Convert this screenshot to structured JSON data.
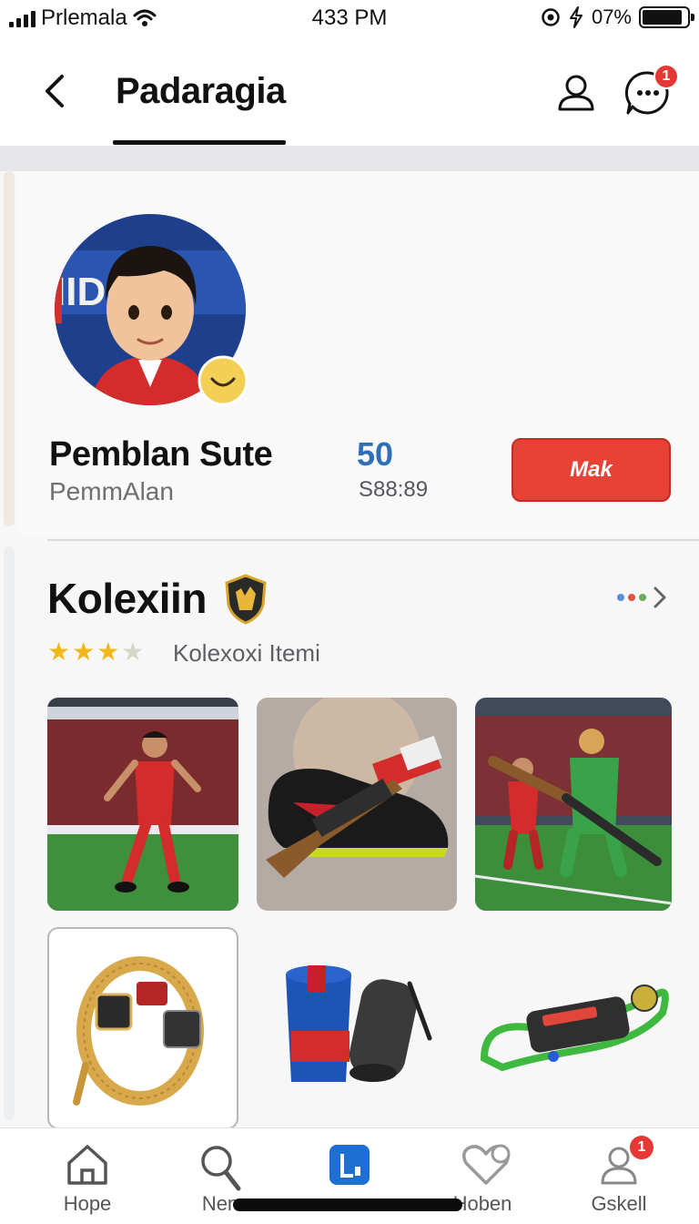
{
  "status_bar": {
    "carrier": "Prlemala",
    "time": "433 PM",
    "battery": "07%"
  },
  "header": {
    "title": "Padaragia",
    "notification_count": "1"
  },
  "profile": {
    "name": "Pemblan Sute",
    "subtitle": "PemmAlan",
    "stat_value": "50",
    "stat_label": "S88:89",
    "action_label": "Mak"
  },
  "collection": {
    "title": "Kolexiin",
    "subtitle": "Kolexoxi Itemi",
    "rating": 3,
    "rating_max": 4
  },
  "bottom_nav": {
    "items": [
      {
        "label": "Hope",
        "icon": "home-icon"
      },
      {
        "label": "Nen",
        "icon": "search-icon"
      },
      {
        "label": "",
        "icon": "app-center-icon"
      },
      {
        "label": "Hoben",
        "icon": "heart-icon"
      },
      {
        "label": "Gskell",
        "icon": "profile-icon"
      }
    ],
    "profile_badge": "1"
  },
  "colors": {
    "accent_red": "#e84236",
    "stat_blue": "#2f6fb8",
    "nav_center_blue": "#1f6ed4"
  }
}
